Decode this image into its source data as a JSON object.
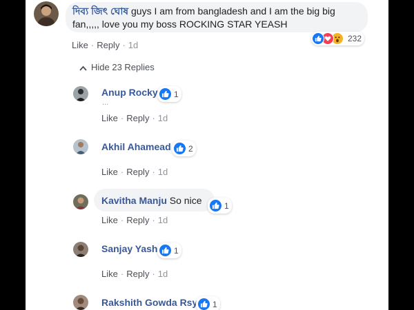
{
  "main_comment": {
    "author": "দিব্য জিৎ ঘোষ",
    "text": "guys I am from bangladesh and I am the big big fan,,,,, love you my boss ROCKING STAR YEASH",
    "reaction_count": "232",
    "actions": {
      "like": "Like",
      "reply": "Reply",
      "time": "1d"
    }
  },
  "toggle_replies": {
    "label": "Hide 23 Replies",
    "icon": "chevron-up-icon"
  },
  "replies": [
    {
      "author": "Anup Rocky",
      "text": "",
      "likes": "1",
      "extra": "...",
      "like": "Like",
      "reply": "Reply",
      "time": "1d"
    },
    {
      "author": "Akhil Ahamead",
      "text": "",
      "likes": "2",
      "like": "Like",
      "reply": "Reply",
      "time": "1d"
    },
    {
      "author": "Kavitha Manju",
      "text": "So nice",
      "likes": "1",
      "like": "Like",
      "reply": "Reply",
      "time": "1d"
    },
    {
      "author": "Sanjay Yash",
      "text": "",
      "likes": "1",
      "like": "Like",
      "reply": "Reply",
      "time": "1d"
    },
    {
      "author": "Rakshith Gowda Rsy",
      "text": "",
      "likes": "1"
    }
  ],
  "colors": {
    "link": "#385898",
    "like_blue": "#1877f2",
    "love_red": "#f33e58",
    "wow_yellow": "#f7b125"
  }
}
